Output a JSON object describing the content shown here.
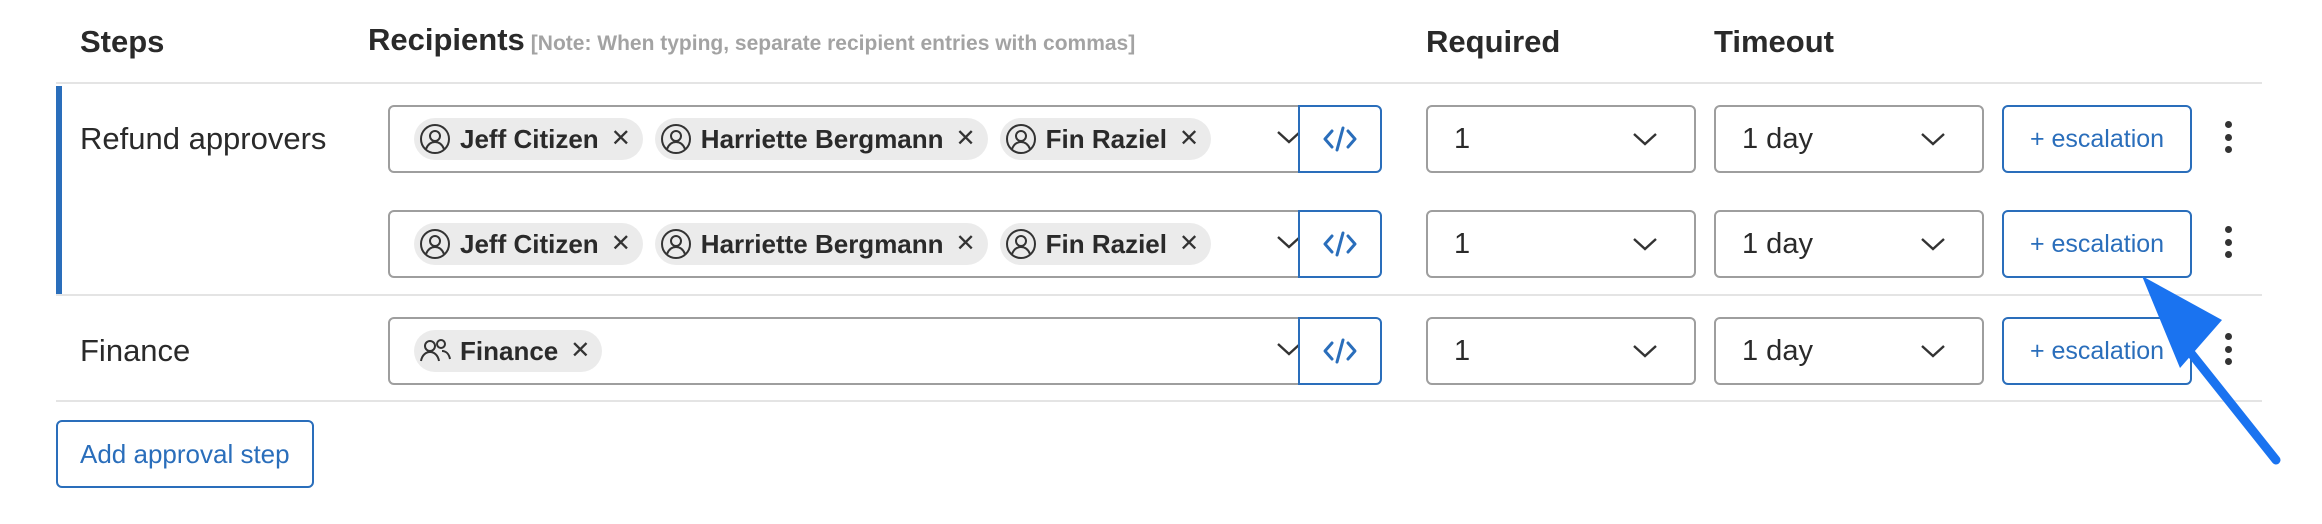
{
  "headers": {
    "steps": "Steps",
    "recipients": "Recipients",
    "recipients_note": "[Note: When typing, separate recipient entries with commas]",
    "required": "Required",
    "timeout": "Timeout"
  },
  "steps": [
    {
      "label": "Refund approvers",
      "rows": [
        {
          "recipients": [
            {
              "name": "Jeff Citizen",
              "icon": "user-icon"
            },
            {
              "name": "Harriette Bergmann",
              "icon": "user-icon"
            },
            {
              "name": "Fin Raziel",
              "icon": "user-icon"
            }
          ],
          "required": "1",
          "timeout": "1 day",
          "escalation_label": "+ escalation"
        },
        {
          "recipients": [
            {
              "name": "Jeff Citizen",
              "icon": "user-icon"
            },
            {
              "name": "Harriette Bergmann",
              "icon": "user-icon"
            },
            {
              "name": "Fin Raziel",
              "icon": "user-icon"
            }
          ],
          "required": "1",
          "timeout": "1 day",
          "escalation_label": "+ escalation"
        }
      ]
    },
    {
      "label": "Finance",
      "rows": [
        {
          "recipients": [
            {
              "name": "Finance",
              "icon": "group-icon"
            }
          ],
          "required": "1",
          "timeout": "1 day",
          "escalation_label": "+ escalation"
        }
      ]
    }
  ],
  "add_step_label": "Add approval step",
  "colors": {
    "accent": "#2a6ebb",
    "annotation_arrow": "#1a73f0",
    "chip_bg": "#ebebeb",
    "border": "#9e9e9e"
  }
}
